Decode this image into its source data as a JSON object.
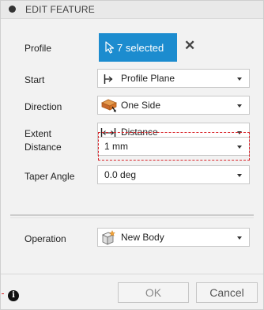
{
  "panel": {
    "title": "EDIT FEATURE"
  },
  "rows": {
    "profile": {
      "label": "Profile",
      "button_label": "7 selected"
    },
    "start": {
      "label": "Start",
      "value": "Profile Plane"
    },
    "direction": {
      "label": "Direction",
      "value": "One Side"
    },
    "extent": {
      "label": "Extent",
      "value": "Distance"
    },
    "distance": {
      "label": "Distance",
      "value": "1 mm"
    },
    "taper": {
      "label": "Taper Angle",
      "value": "0.0 deg"
    },
    "operation": {
      "label": "Operation",
      "value": "New Body"
    }
  },
  "footer": {
    "ok_label": "OK",
    "cancel_label": "Cancel"
  },
  "colors": {
    "accent": "#1c8ccf",
    "highlight_dashed": "#d9262c",
    "direction_icon": "#d9762a"
  },
  "icons": {
    "profile": "cursor-arrow-icon",
    "clear": "close-icon",
    "start": "profile-plane-icon",
    "direction": "one-side-icon",
    "extent": "distance-arrows-icon",
    "operation": "new-body-icon",
    "info": "info-icon"
  }
}
